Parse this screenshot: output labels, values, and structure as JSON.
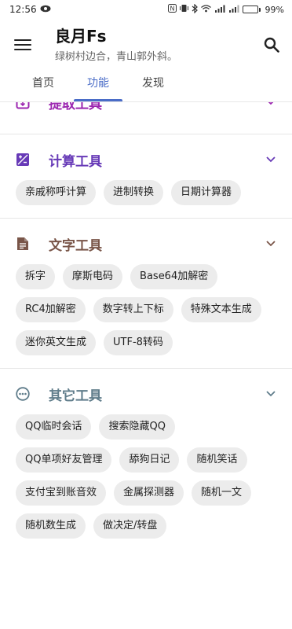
{
  "status_bar": {
    "time": "12:56",
    "battery": "99%"
  },
  "app_bar": {
    "title": "良月Fs",
    "subtitle": "绿树村边合，青山郭外斜。"
  },
  "tabs": [
    {
      "label": "首页"
    },
    {
      "label": "功能"
    },
    {
      "label": "发现"
    }
  ],
  "sections": {
    "extract": {
      "title": "提取工具",
      "color": "#9c27b0"
    },
    "calc": {
      "title": "计算工具",
      "color": "#673ab7",
      "items": [
        "亲戚称呼计算",
        "进制转换",
        "日期计算器"
      ]
    },
    "text": {
      "title": "文字工具",
      "color": "#795548",
      "items": [
        "拆字",
        "摩斯电码",
        "Base64加解密",
        "RC4加解密",
        "数字转上下标",
        "特殊文本生成",
        "迷你英文生成",
        "UTF-8转码"
      ]
    },
    "other": {
      "title": "其它工具",
      "color": "#607d8b",
      "items": [
        "QQ临时会话",
        "搜索隐藏QQ",
        "QQ单项好友管理",
        "舔狗日记",
        "随机笑话",
        "支付宝到账音效",
        "金属探测器",
        "随机一文",
        "随机数生成",
        "做决定/转盘"
      ]
    }
  }
}
